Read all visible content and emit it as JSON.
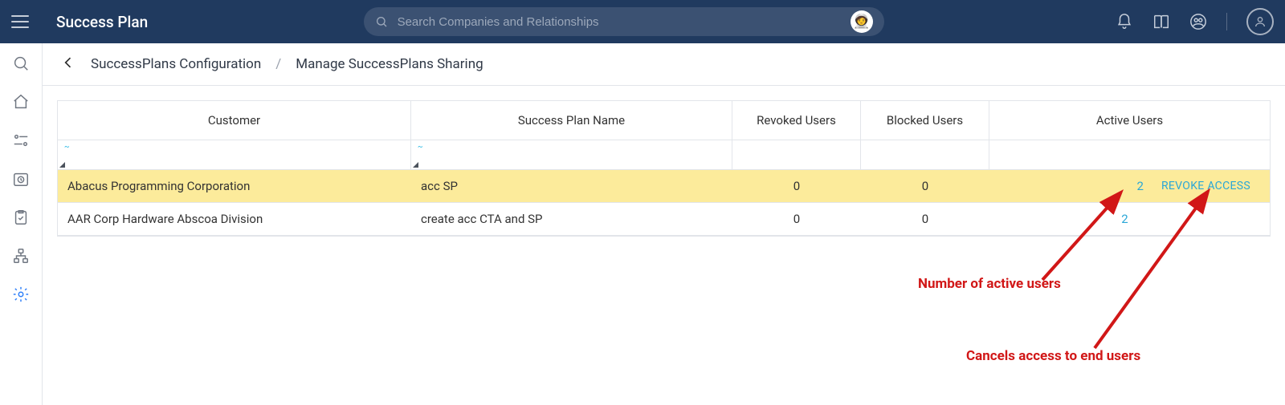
{
  "header": {
    "app_title": "Success Plan",
    "search_placeholder": "Search Companies and Relationships"
  },
  "breadcrumb": {
    "parent": "SuccessPlans Configuration",
    "separator": "/",
    "current": "Manage SuccessPlans Sharing"
  },
  "table": {
    "headers": {
      "customer": "Customer",
      "plan_name": "Success Plan Name",
      "revoked": "Revoked Users",
      "blocked": "Blocked Users",
      "active": "Active Users"
    },
    "rows": [
      {
        "customer": "Abacus Programming Corporation",
        "plan_name": "acc SP",
        "revoked": "0",
        "blocked": "0",
        "active": "2",
        "revoke_label": "REVOKE ACCESS",
        "highlight": true
      },
      {
        "customer": "AAR Corp Hardware Abscoa Division",
        "plan_name": "create acc CTA and SP",
        "revoked": "0",
        "blocked": "0",
        "active": "2",
        "revoke_label": "",
        "highlight": false
      }
    ]
  },
  "annotations": {
    "active_users_note": "Number of active users",
    "revoke_note": "Cancels access to end users"
  }
}
